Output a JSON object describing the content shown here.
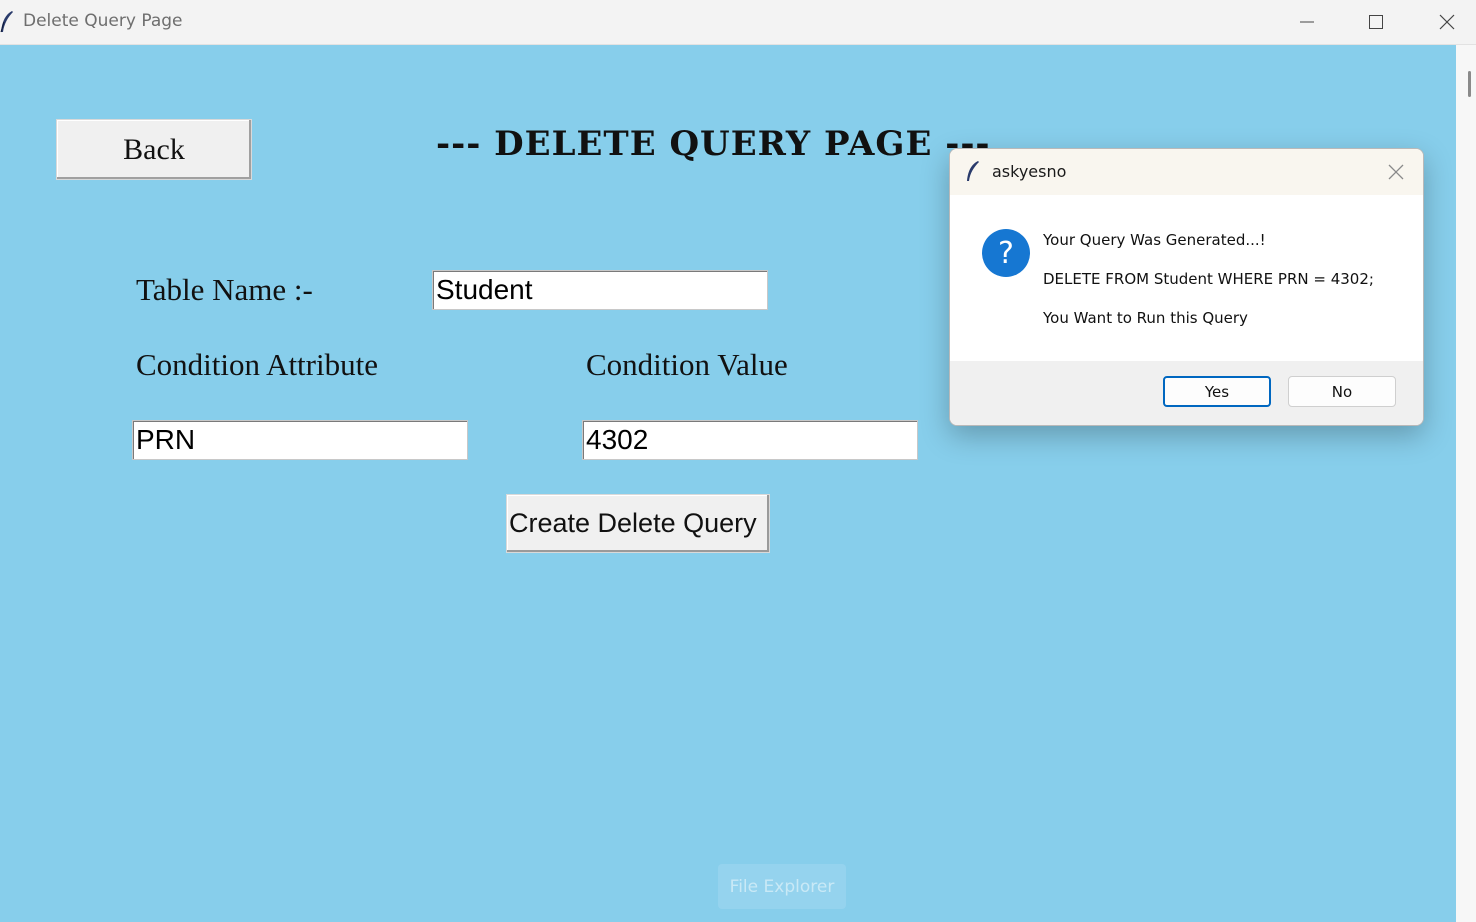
{
  "window": {
    "title": "Delete Query Page"
  },
  "icons": {
    "app": "feather-icon",
    "minimize": "minimize-icon",
    "maximize": "maximize-icon",
    "close": "close-icon",
    "question": "question-icon"
  },
  "colors": {
    "background": "#87ceeb",
    "dialog_accent": "#0067c0",
    "question_icon": "#1677d2"
  },
  "main": {
    "back_label": "Back",
    "page_title": "--- DELETE QUERY PAGE ---",
    "table_name_label": "Table Name :-",
    "table_name_value": "Student",
    "condition_attribute_label": "Condition Attribute",
    "condition_attribute_value": "PRN",
    "condition_value_label": "Condition Value",
    "condition_value_value": "4302",
    "create_button_label": "Create Delete Query"
  },
  "tooltip": {
    "text": "File Explorer"
  },
  "dialog": {
    "title": "askyesno",
    "question_glyph": "?",
    "message_line1": "Your Query Was Generated...!",
    "message_line2": "DELETE FROM Student WHERE PRN = 4302;",
    "message_line3": "You Want to Run this Query",
    "yes_label": "Yes",
    "no_label": "No"
  }
}
